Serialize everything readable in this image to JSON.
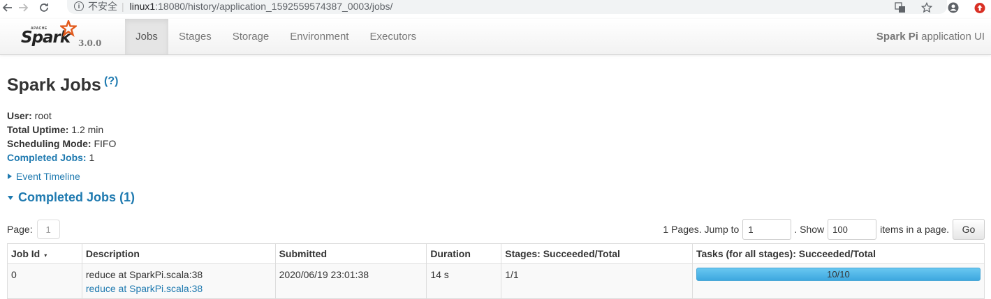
{
  "browser": {
    "security_label": "不安全",
    "url_host": "linux1",
    "url_rest": ":18080/history/application_1592559574387_0003/jobs/"
  },
  "navbar": {
    "brand_apache": "APACHE",
    "brand_name": "Spark",
    "version": "3.0.0",
    "tabs": [
      {
        "label": "Jobs",
        "active": true
      },
      {
        "label": "Stages",
        "active": false
      },
      {
        "label": "Storage",
        "active": false
      },
      {
        "label": "Environment",
        "active": false
      },
      {
        "label": "Executors",
        "active": false
      }
    ],
    "app_name": "Spark Pi",
    "app_suffix": " application UI"
  },
  "page": {
    "title": "Spark Jobs",
    "help": "(?)"
  },
  "summary": {
    "user_label": "User:",
    "user_value": " root",
    "uptime_label": "Total Uptime:",
    "uptime_value": " 1.2 min",
    "scheduling_label": "Scheduling Mode:",
    "scheduling_value": " FIFO",
    "completed_label": "Completed Jobs:",
    "completed_value": " 1"
  },
  "timeline": {
    "label": "Event Timeline"
  },
  "completed_section": {
    "label": "Completed Jobs (1)"
  },
  "pager": {
    "page_label": "Page:",
    "current_page": "1",
    "pages_text": "1 Pages. Jump to",
    "jump_value": "1",
    "show_label": ". Show",
    "show_value": "100",
    "items_text": "items in a page.",
    "go_label": "Go"
  },
  "table": {
    "headers": {
      "job_id": "Job Id",
      "description": "Description",
      "submitted": "Submitted",
      "duration": "Duration",
      "stages": "Stages: Succeeded/Total",
      "tasks": "Tasks (for all stages): Succeeded/Total"
    },
    "sort_indicator": "▾",
    "rows": [
      {
        "job_id": "0",
        "description": "reduce at SparkPi.scala:38",
        "description_link": "reduce at SparkPi.scala:38",
        "submitted": "2020/06/19 23:01:38",
        "duration": "14 s",
        "stages": "1/1",
        "tasks": "10/10",
        "tasks_fraction": 1.0
      }
    ]
  },
  "colors": {
    "link": "#1f7ab0",
    "progress": "#3ea8e0",
    "spark_orange": "#e25a1c"
  }
}
